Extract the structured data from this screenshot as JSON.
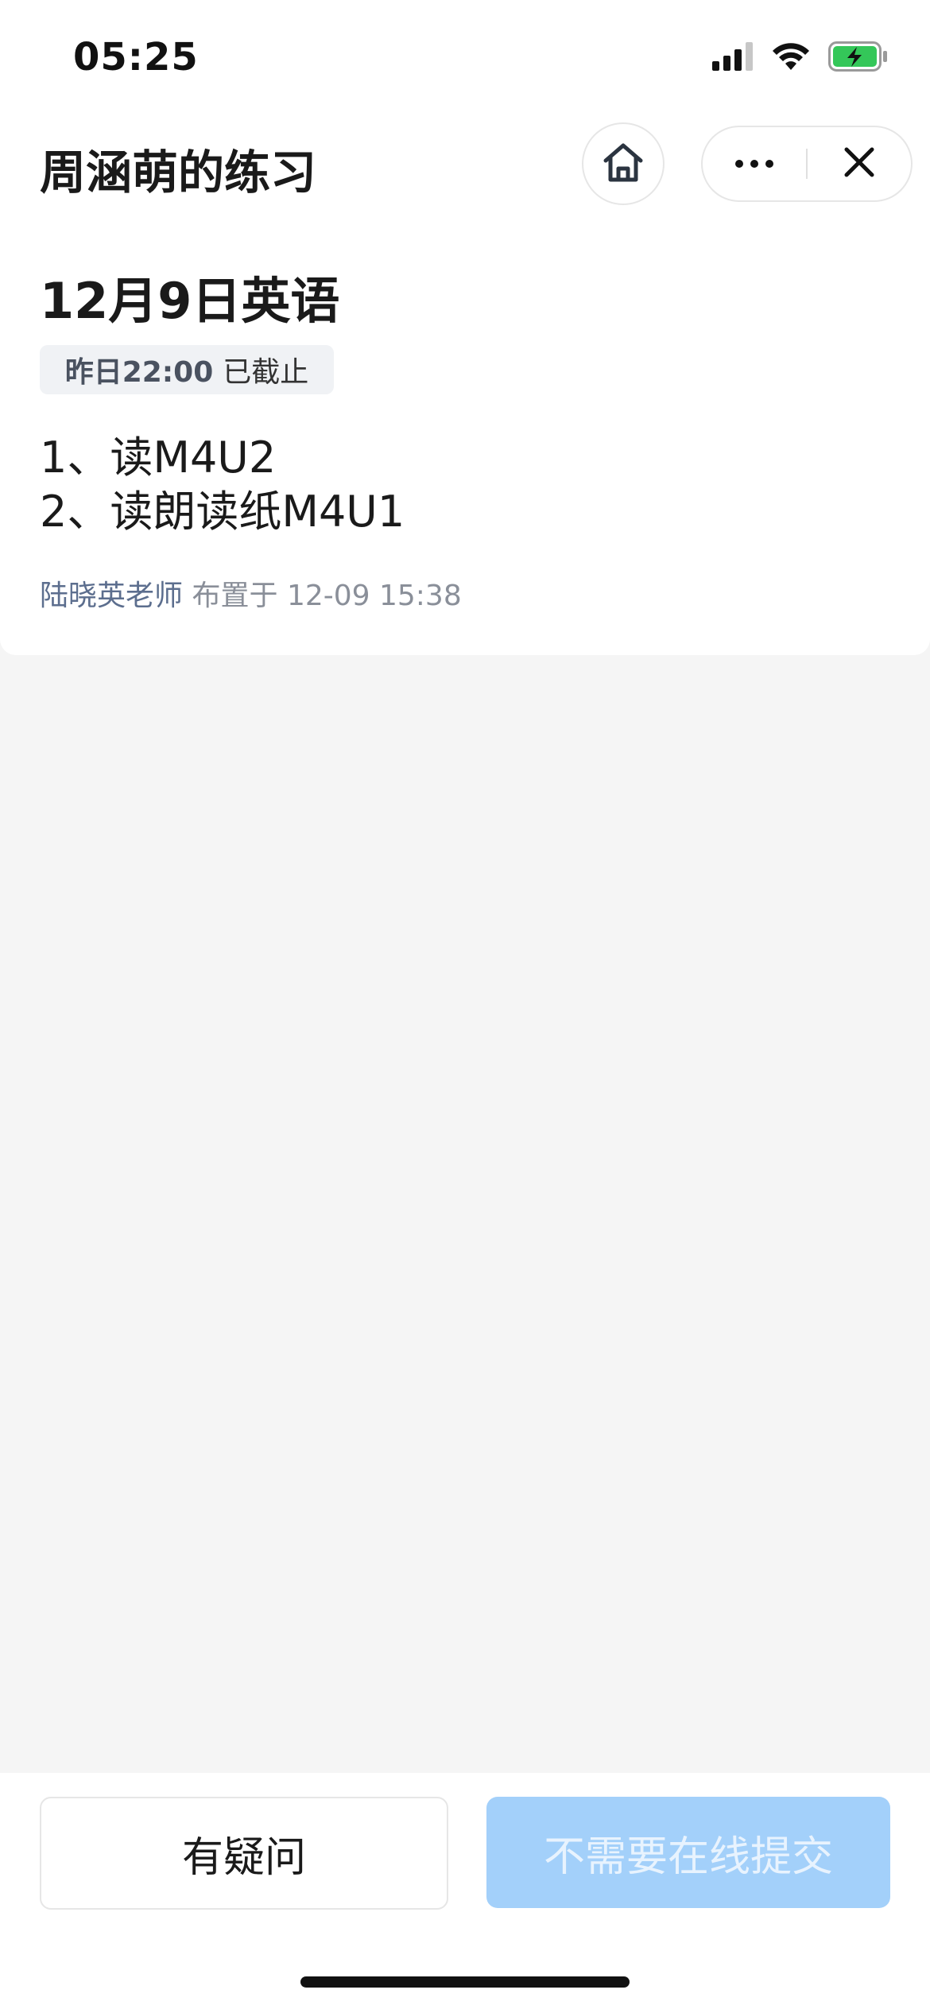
{
  "status_bar": {
    "time": "05:25",
    "icons": [
      "cellular-signal-icon",
      "wifi-icon",
      "battery-charging-icon"
    ],
    "battery_color": "#34c759"
  },
  "nav": {
    "title": "周涵萌的练习",
    "icons": [
      "home-icon",
      "more-icon",
      "close-icon"
    ]
  },
  "homework": {
    "title": "12月9日英语",
    "deadline_time": "昨日22:00",
    "deadline_status": "已截止",
    "content": [
      "1、读M4U2",
      "2、读朗读纸M4U1"
    ],
    "teacher": "陆晓英老师",
    "assigned_label": "布置于",
    "assigned_time": "12-09 15:38"
  },
  "actions": {
    "question_label": "有疑问",
    "submit_label": "不需要在线提交",
    "submit_color": "#a3d0fa"
  }
}
